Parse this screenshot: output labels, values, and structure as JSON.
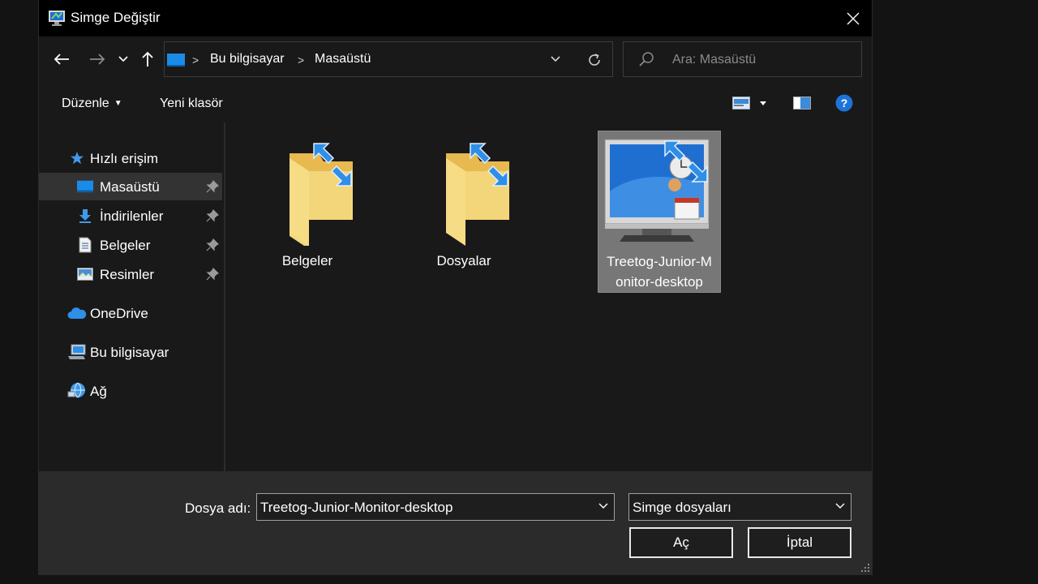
{
  "window": {
    "title": "Simge Değiştir",
    "close_icon": "close-icon",
    "app_icon": "monitor-app-icon"
  },
  "nav": {
    "back_icon": "arrow-left-icon",
    "forward_icon": "arrow-right-icon",
    "recent_icon": "chevron-down-icon",
    "up_icon": "arrow-up-icon"
  },
  "address": {
    "crumbs": [
      "Bu bilgisayar",
      "Masaüstü"
    ],
    "separator": ">"
  },
  "search": {
    "placeholder": "Ara: Masaüstü"
  },
  "toolbar": {
    "organize_label": "Düzenle",
    "new_folder_label": "Yeni klasör",
    "help_label": "?"
  },
  "sidebar": {
    "quick_access": "Hızlı erişim",
    "items": [
      {
        "label": "Masaüstü",
        "icon": "desktop-icon",
        "pinned": true,
        "selected": true
      },
      {
        "label": "İndirilenler",
        "icon": "download-icon",
        "pinned": true
      },
      {
        "label": "Belgeler",
        "icon": "document-icon",
        "pinned": true
      },
      {
        "label": "Resimler",
        "icon": "picture-icon",
        "pinned": true
      }
    ],
    "onedrive": "OneDrive",
    "this_pc": "Bu bilgisayar",
    "network": "Ağ"
  },
  "content": {
    "items": [
      {
        "label": "Belgeler",
        "icon": "folder-shortcut-icon"
      },
      {
        "label": "Dosyalar",
        "icon": "folder-shortcut-icon"
      },
      {
        "label": "Treetog-Junior-Monitor-desktop",
        "label_line1": "Treetog-Junior-M",
        "label_line2": "onitor-desktop",
        "icon": "monitor-icon-file",
        "selected": true
      }
    ]
  },
  "footer": {
    "filename_label": "Dosya adı:",
    "filename_value": "Treetog-Junior-Monitor-desktop",
    "filetype_value": "Simge dosyaları",
    "open_label": "Aç",
    "cancel_label": "İptal"
  },
  "colors": {
    "accent": "#0a84ff",
    "folder": "#f3d57a",
    "selection": "#777777",
    "titlebar": "#000000"
  }
}
